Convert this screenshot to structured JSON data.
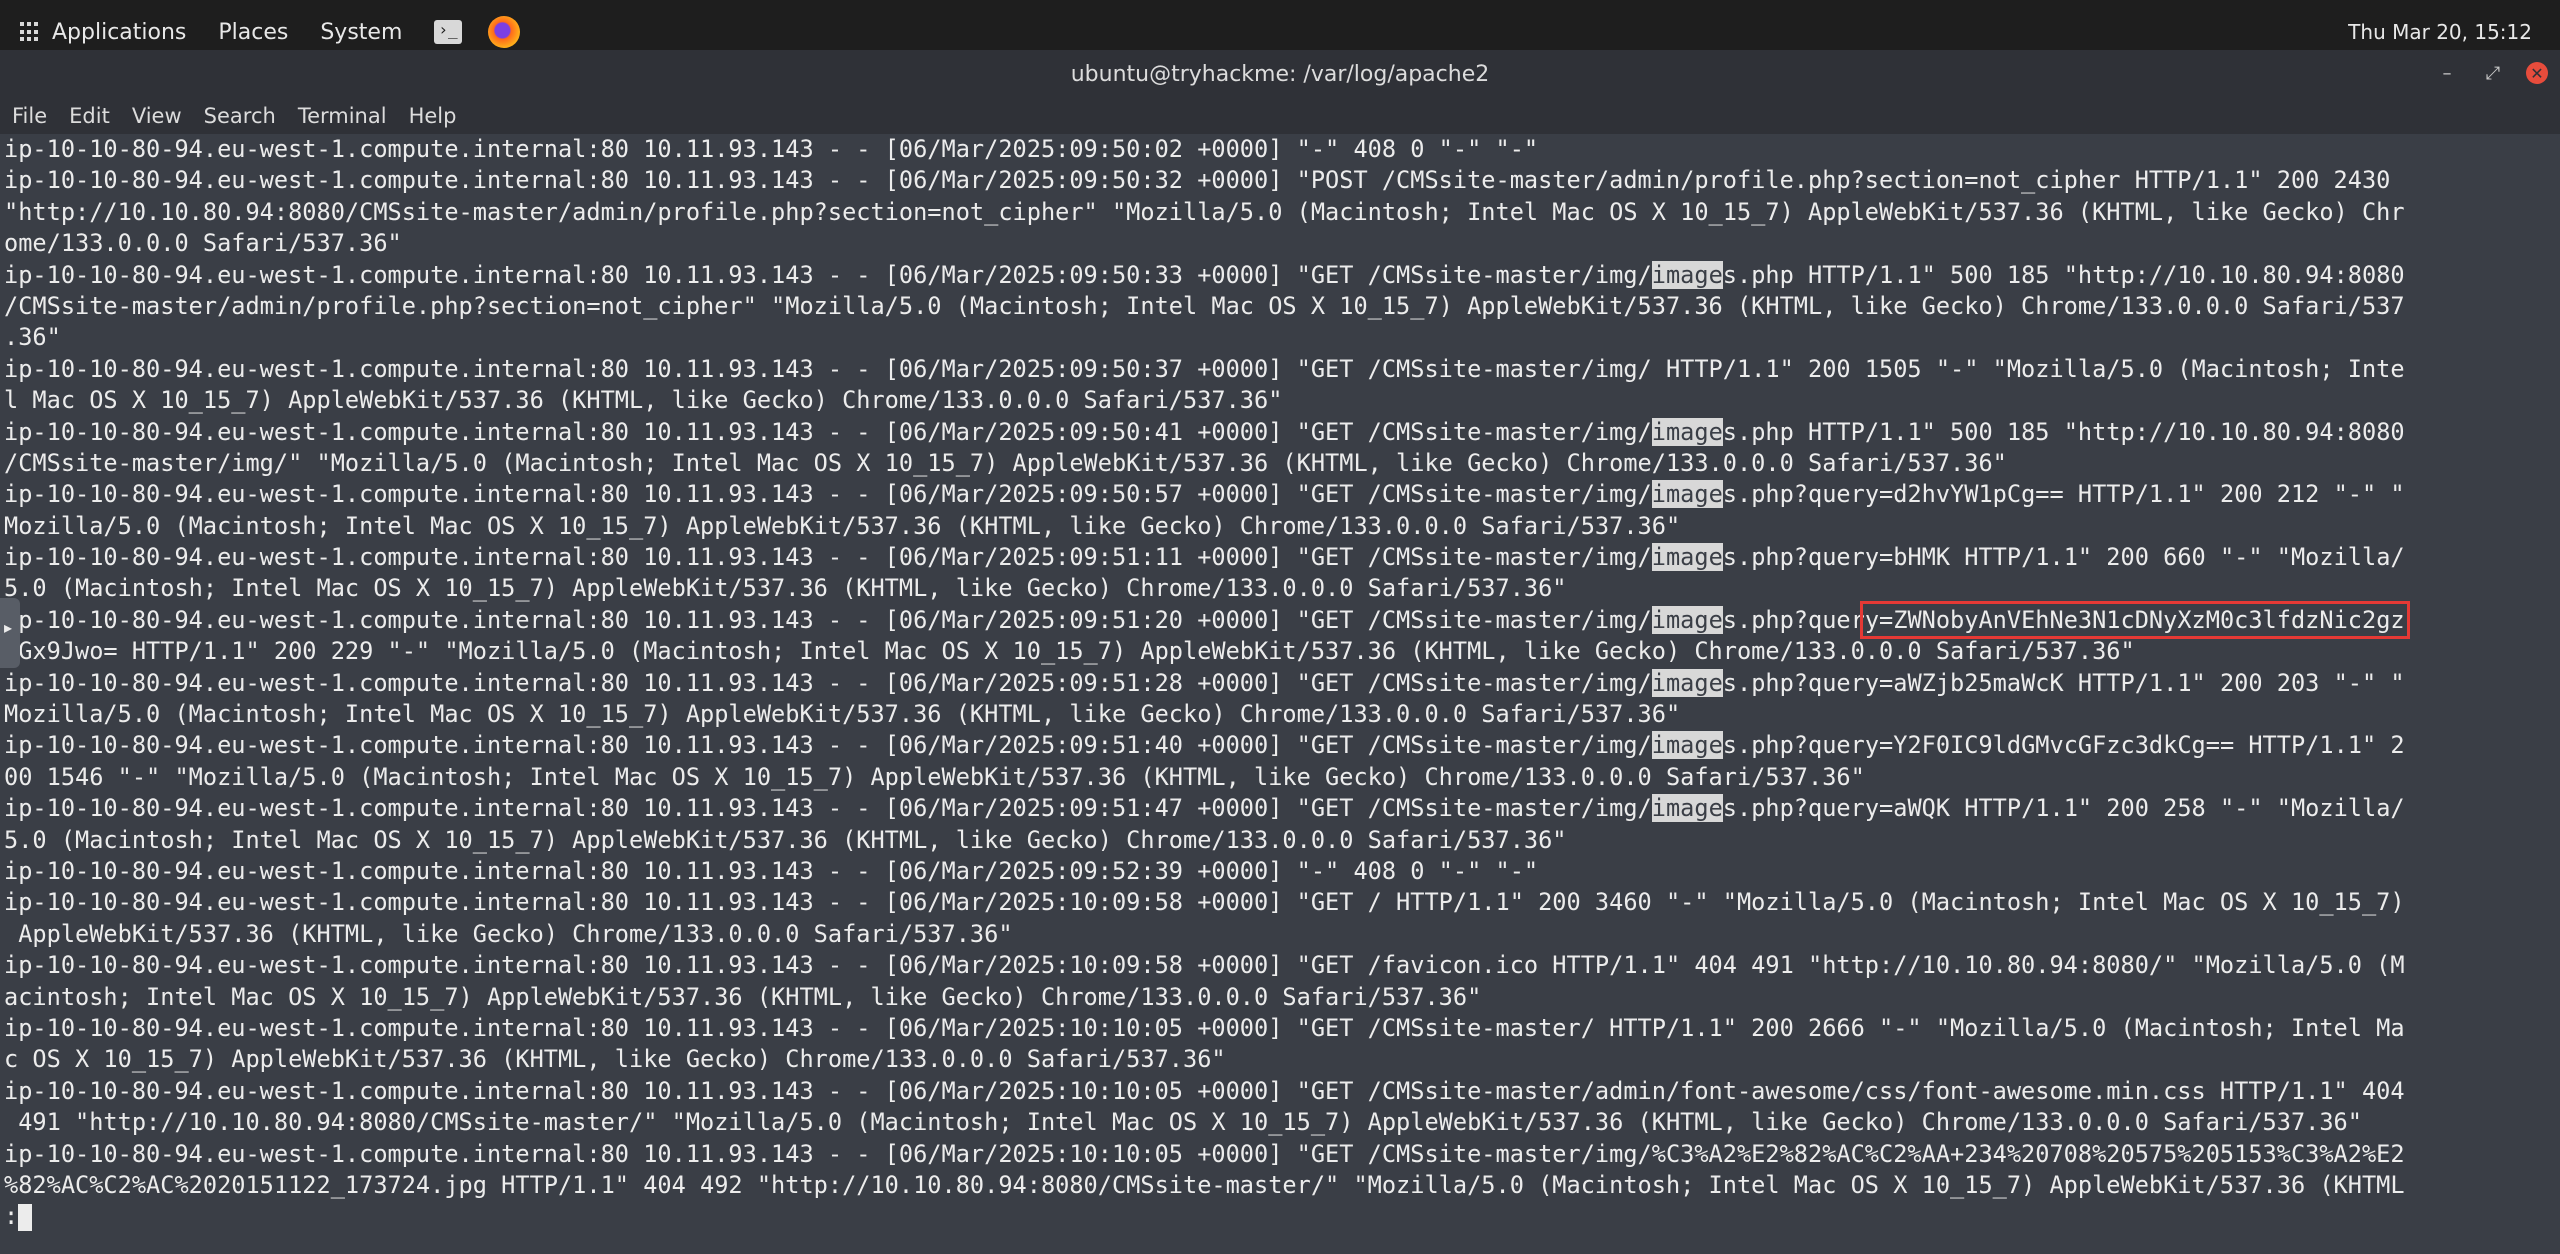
{
  "topbar": {
    "menu": [
      "Applications",
      "Places",
      "System"
    ],
    "clock": "Thu Mar 20, 15:12"
  },
  "window": {
    "title": "ubuntu@tryhackme: /var/log/apache2",
    "controls": {
      "minimize": "–",
      "maximize": "⤢",
      "close": "✕"
    },
    "menubar": [
      "File",
      "Edit",
      "View",
      "Search",
      "Terminal",
      "Help"
    ]
  },
  "terminal": {
    "lines": [
      [
        {
          "t": "ip-10-10-80-94.eu-west-1.compute.internal:80 10.11.93.143 - - [06/Mar/2025:09:50:02 +0000] \"-\" 408 0 \"-\" \"-\""
        }
      ],
      [
        {
          "t": "ip-10-10-80-94.eu-west-1.compute.internal:80 10.11.93.143 - - [06/Mar/2025:09:50:32 +0000] \"POST /CMSsite-master/admin/profile.php?section=not_cipher HTTP/1.1\" 200 2430"
        }
      ],
      [
        {
          "t": "\"http://10.10.80.94:8080/CMSsite-master/admin/profile.php?section=not_cipher\" \"Mozilla/5.0 (Macintosh; Intel Mac OS X 10_15_7) AppleWebKit/537.36 (KHTML, like Gecko) Chr"
        }
      ],
      [
        {
          "t": "ome/133.0.0.0 Safari/537.36\""
        }
      ],
      [
        {
          "t": "ip-10-10-80-94.eu-west-1.compute.internal:80 10.11.93.143 - - [06/Mar/2025:09:50:33 +0000] \"GET /CMSsite-master/img/"
        },
        {
          "t": "image",
          "h": 1
        },
        {
          "t": "s.php HTTP/1.1\" 500 185 \"http://10.10.80.94:8080"
        }
      ],
      [
        {
          "t": "/CMSsite-master/admin/profile.php?section=not_cipher\" \"Mozilla/5.0 (Macintosh; Intel Mac OS X 10_15_7) AppleWebKit/537.36 (KHTML, like Gecko) Chrome/133.0.0.0 Safari/537"
        }
      ],
      [
        {
          "t": ".36\""
        }
      ],
      [
        {
          "t": "ip-10-10-80-94.eu-west-1.compute.internal:80 10.11.93.143 - - [06/Mar/2025:09:50:37 +0000] \"GET /CMSsite-master/img/ HTTP/1.1\" 200 1505 \"-\" \"Mozilla/5.0 (Macintosh; Inte"
        }
      ],
      [
        {
          "t": "l Mac OS X 10_15_7) AppleWebKit/537.36 (KHTML, like Gecko) Chrome/133.0.0.0 Safari/537.36\""
        }
      ],
      [
        {
          "t": "ip-10-10-80-94.eu-west-1.compute.internal:80 10.11.93.143 - - [06/Mar/2025:09:50:41 +0000] \"GET /CMSsite-master/img/"
        },
        {
          "t": "image",
          "h": 1
        },
        {
          "t": "s.php HTTP/1.1\" 500 185 \"http://10.10.80.94:8080"
        }
      ],
      [
        {
          "t": "/CMSsite-master/img/\" \"Mozilla/5.0 (Macintosh; Intel Mac OS X 10_15_7) AppleWebKit/537.36 (KHTML, like Gecko) Chrome/133.0.0.0 Safari/537.36\""
        }
      ],
      [
        {
          "t": "ip-10-10-80-94.eu-west-1.compute.internal:80 10.11.93.143 - - [06/Mar/2025:09:50:57 +0000] \"GET /CMSsite-master/img/"
        },
        {
          "t": "image",
          "h": 1
        },
        {
          "t": "s.php?query=d2hvYW1pCg== HTTP/1.1\" 200 212 \"-\" \""
        }
      ],
      [
        {
          "t": "Mozilla/5.0 (Macintosh; Intel Mac OS X 10_15_7) AppleWebKit/537.36 (KHTML, like Gecko) Chrome/133.0.0.0 Safari/537.36\""
        }
      ],
      [
        {
          "t": "ip-10-10-80-94.eu-west-1.compute.internal:80 10.11.93.143 - - [06/Mar/2025:09:51:11 +0000] \"GET /CMSsite-master/img/"
        },
        {
          "t": "image",
          "h": 1
        },
        {
          "t": "s.php?query=bHMK HTTP/1.1\" 200 660 \"-\" \"Mozilla/"
        }
      ],
      [
        {
          "t": "5.0 (Macintosh; Intel Mac OS X 10_15_7) AppleWebKit/537.36 (KHTML, like Gecko) Chrome/133.0.0.0 Safari/537.36\""
        }
      ],
      [
        {
          "t": "ip-10-10-80-94.eu-west-1.compute.internal:80 10.11.93.143 - - [06/Mar/2025:09:51:20 +0000] \"GET /CMSsite-master/img/"
        },
        {
          "t": "image",
          "h": 1
        },
        {
          "t": "s.php?quer"
        },
        {
          "t": "y=ZWNobyAnVEhNe3N1cDNyXzM0c3lfdzNic2gz",
          "b": 1
        }
      ],
      [
        {
          "t": "bGx9Jwo= HTTP/1.1\" 200 229 \"-\" \"Mozilla/5.0 (Macintosh; Intel Mac OS X 10_15_7) AppleWebKit/537.36 (KHTML, like Gecko) Chrome/133.0.0.0 Safari/537.36\""
        }
      ],
      [
        {
          "t": "ip-10-10-80-94.eu-west-1.compute.internal:80 10.11.93.143 - - [06/Mar/2025:09:51:28 +0000] \"GET /CMSsite-master/img/"
        },
        {
          "t": "image",
          "h": 1
        },
        {
          "t": "s.php?query=aWZjb25maWcK HTTP/1.1\" 200 203 \"-\" \""
        }
      ],
      [
        {
          "t": "Mozilla/5.0 (Macintosh; Intel Mac OS X 10_15_7) AppleWebKit/537.36 (KHTML, like Gecko) Chrome/133.0.0.0 Safari/537.36\""
        }
      ],
      [
        {
          "t": "ip-10-10-80-94.eu-west-1.compute.internal:80 10.11.93.143 - - [06/Mar/2025:09:51:40 +0000] \"GET /CMSsite-master/img/"
        },
        {
          "t": "image",
          "h": 1
        },
        {
          "t": "s.php?query=Y2F0IC9ldGMvcGFzc3dkCg== HTTP/1.1\" 2"
        }
      ],
      [
        {
          "t": "00 1546 \"-\" \"Mozilla/5.0 (Macintosh; Intel Mac OS X 10_15_7) AppleWebKit/537.36 (KHTML, like Gecko) Chrome/133.0.0.0 Safari/537.36\""
        }
      ],
      [
        {
          "t": "ip-10-10-80-94.eu-west-1.compute.internal:80 10.11.93.143 - - [06/Mar/2025:09:51:47 +0000] \"GET /CMSsite-master/img/"
        },
        {
          "t": "image",
          "h": 1
        },
        {
          "t": "s.php?query=aWQK HTTP/1.1\" 200 258 \"-\" \"Mozilla/"
        }
      ],
      [
        {
          "t": "5.0 (Macintosh; Intel Mac OS X 10_15_7) AppleWebKit/537.36 (KHTML, like Gecko) Chrome/133.0.0.0 Safari/537.36\""
        }
      ],
      [
        {
          "t": "ip-10-10-80-94.eu-west-1.compute.internal:80 10.11.93.143 - - [06/Mar/2025:09:52:39 +0000] \"-\" 408 0 \"-\" \"-\""
        }
      ],
      [
        {
          "t": "ip-10-10-80-94.eu-west-1.compute.internal:80 10.11.93.143 - - [06/Mar/2025:10:09:58 +0000] \"GET / HTTP/1.1\" 200 3460 \"-\" \"Mozilla/5.0 (Macintosh; Intel Mac OS X 10_15_7)"
        }
      ],
      [
        {
          "t": " AppleWebKit/537.36 (KHTML, like Gecko) Chrome/133.0.0.0 Safari/537.36\""
        }
      ],
      [
        {
          "t": "ip-10-10-80-94.eu-west-1.compute.internal:80 10.11.93.143 - - [06/Mar/2025:10:09:58 +0000] \"GET /favicon.ico HTTP/1.1\" 404 491 \"http://10.10.80.94:8080/\" \"Mozilla/5.0 (M"
        }
      ],
      [
        {
          "t": "acintosh; Intel Mac OS X 10_15_7) AppleWebKit/537.36 (KHTML, like Gecko) Chrome/133.0.0.0 Safari/537.36\""
        }
      ],
      [
        {
          "t": "ip-10-10-80-94.eu-west-1.compute.internal:80 10.11.93.143 - - [06/Mar/2025:10:10:05 +0000] \"GET /CMSsite-master/ HTTP/1.1\" 200 2666 \"-\" \"Mozilla/5.0 (Macintosh; Intel Ma"
        }
      ],
      [
        {
          "t": "c OS X 10_15_7) AppleWebKit/537.36 (KHTML, like Gecko) Chrome/133.0.0.0 Safari/537.36\""
        }
      ],
      [
        {
          "t": "ip-10-10-80-94.eu-west-1.compute.internal:80 10.11.93.143 - - [06/Mar/2025:10:10:05 +0000] \"GET /CMSsite-master/admin/font-awesome/css/font-awesome.min.css HTTP/1.1\" 404"
        }
      ],
      [
        {
          "t": " 491 \"http://10.10.80.94:8080/CMSsite-master/\" \"Mozilla/5.0 (Macintosh; Intel Mac OS X 10_15_7) AppleWebKit/537.36 (KHTML, like Gecko) Chrome/133.0.0.0 Safari/537.36\""
        }
      ],
      [
        {
          "t": "ip-10-10-80-94.eu-west-1.compute.internal:80 10.11.93.143 - - [06/Mar/2025:10:10:05 +0000] \"GET /CMSsite-master/img/%C3%A2%E2%82%AC%C2%AA+234%20708%20575%205153%C3%A2%E2"
        }
      ],
      [
        {
          "t": "%82%AC%C2%AC%2020151122_173724.jpg HTTP/1.1\" 404 492 \"http://10.10.80.94:8080/CMSsite-master/\" \"Mozilla/5.0 (Macintosh; Intel Mac OS X 10_15_7) AppleWebKit/537.36 (KHTML"
        }
      ],
      [
        {
          "t": ":"
        }
      ]
    ]
  }
}
